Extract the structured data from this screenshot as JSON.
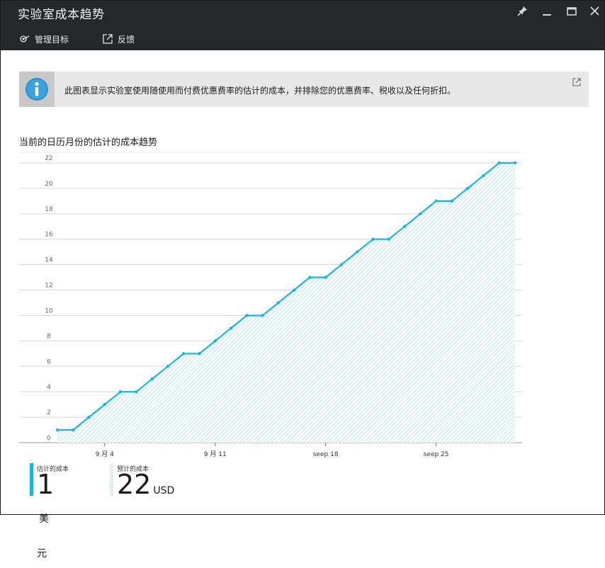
{
  "window": {
    "title": "实验室成本趋势",
    "controls": {
      "pin": "pin-icon",
      "minimize": "minimize-icon",
      "maximize": "maximize-icon",
      "close": "close-icon"
    }
  },
  "commands": [
    {
      "label": "管理目标",
      "icon": "target-icon"
    },
    {
      "label": "反馈",
      "icon": "external-link-icon"
    }
  ],
  "info_banner": {
    "text": "此图表显示实验室使用随使用而付费优惠费率的估计的成本，并排除您的优惠费率、税收以及任何折扣。",
    "icon": "info-icon"
  },
  "chart_title": "当前的日历月份的估计的成本趋势",
  "chart_data": {
    "type": "area",
    "x_tick_labels": [
      "9 月 4",
      "9 月 11",
      "seep 18",
      "seep 25"
    ],
    "x_tick_days": [
      4,
      11,
      18,
      25
    ],
    "x": [
      1,
      2,
      3,
      4,
      5,
      6,
      7,
      8,
      9,
      10,
      11,
      12,
      13,
      14,
      15,
      16,
      17,
      18,
      19,
      20,
      21,
      22,
      23,
      24,
      25,
      26,
      27,
      28,
      29,
      30
    ],
    "values": [
      1,
      1,
      2,
      3,
      4,
      4,
      5,
      6,
      7,
      7,
      8,
      9,
      10,
      10,
      11,
      12,
      13,
      13,
      14,
      15,
      16,
      16,
      17,
      18,
      19,
      19,
      20,
      21,
      22,
      22
    ],
    "ylim": [
      0,
      22
    ],
    "y_ticks": [
      0,
      2,
      4,
      6,
      8,
      10,
      12,
      14,
      16,
      18,
      20,
      22
    ],
    "grid": true,
    "line_color": "#1ab3e6",
    "fill_color": "#a9dbe9"
  },
  "legend": [
    {
      "label": "估计的成本",
      "value": "1",
      "unit": "美元",
      "style": "solid"
    },
    {
      "label": "预计的成本",
      "value": "22",
      "unit": "USD",
      "style": "hatched"
    }
  ],
  "colors": {
    "titlebar": "#25282b",
    "accent": "#1ab3e6",
    "banner": "#e8e8e8"
  }
}
